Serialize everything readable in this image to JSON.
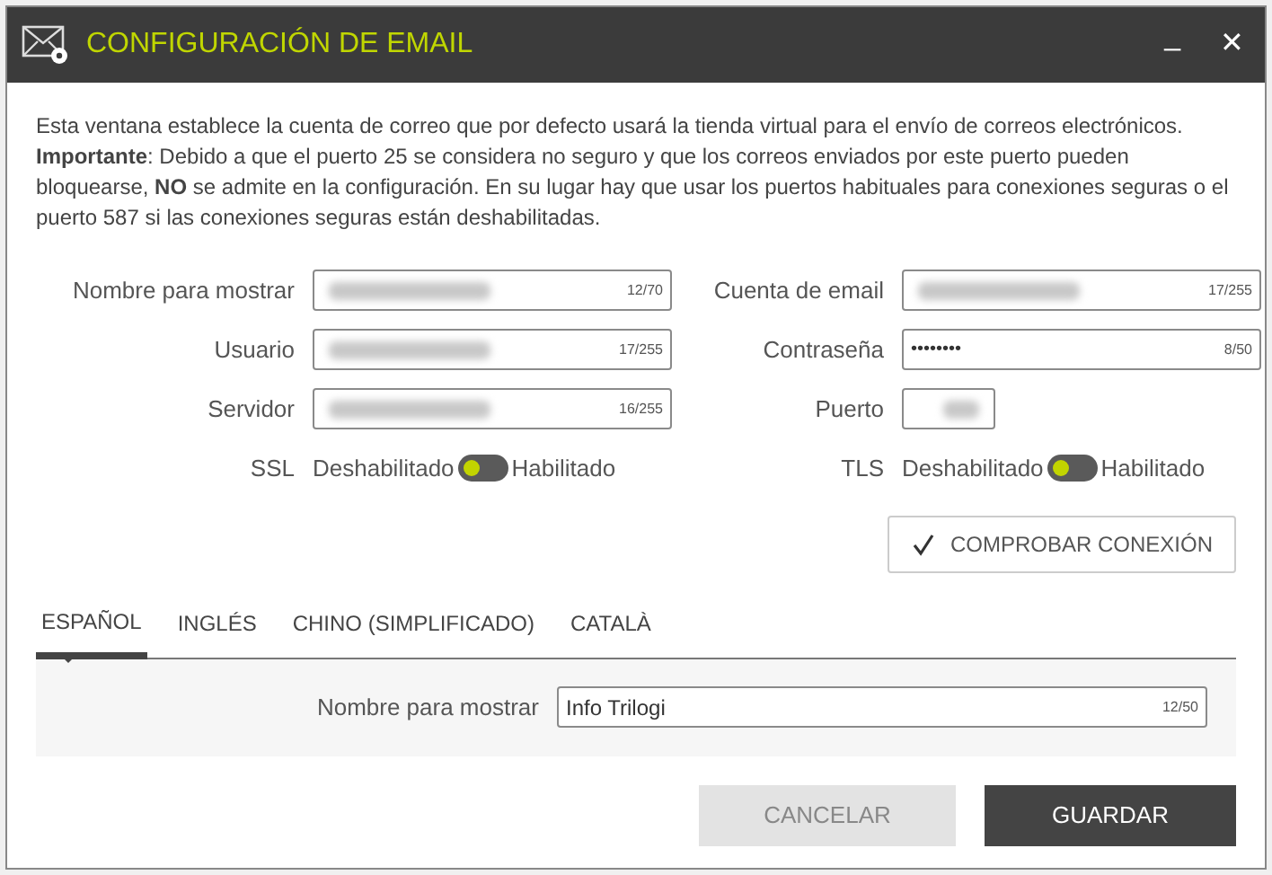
{
  "window": {
    "title": "CONFIGURACIÓN DE EMAIL",
    "minimize": "_",
    "close": "✕"
  },
  "description": "Esta ventana establece la cuenta de correo que por defecto usará la tienda virtual para el envío de correos electrónicos. **Importante**: Debido a que el puerto 25 se considera no seguro y que los correos enviados por este puerto pueden bloquearse, **NO** se admite en la configuración. En su lugar hay que usar los puertos habituales para conexiones seguras o el puerto 587 si las conexiones seguras están deshabilitadas.",
  "left_fields": [
    {
      "label": "Nombre para mostrar",
      "kind": "blurred",
      "counter": "12/70"
    },
    {
      "label": "Usuario",
      "kind": "blurred",
      "counter": "17/255"
    },
    {
      "label": "Servidor",
      "kind": "blurred",
      "counter": "16/255"
    }
  ],
  "right_fields": [
    {
      "label": "Cuenta de email",
      "kind": "blurred",
      "counter": "17/255"
    },
    {
      "label": "Contraseña",
      "kind": "password",
      "value": "••••••••",
      "counter": "8/50"
    },
    {
      "label": "Puerto",
      "kind": "short"
    }
  ],
  "toggles": [
    {
      "label": "SSL",
      "off_label": "Deshabilitado",
      "on_label": "Habilitado",
      "on": false
    },
    {
      "label": "TLS",
      "off_label": "Deshabilitado",
      "on_label": "Habilitado",
      "on": false
    }
  ],
  "test_button": "COMPROBAR CONEXIÓN",
  "tabs": [
    {
      "label": "ESPAÑOL",
      "selected": true
    },
    {
      "label": "INGLÉS",
      "selected": false
    },
    {
      "label": "CHINO (SIMPLIFICADO)",
      "selected": false
    },
    {
      "label": "CATALÀ",
      "selected": false
    }
  ],
  "tab_field": {
    "label": "Nombre para mostrar",
    "value": "Info Trilogi",
    "counter": "12/50"
  },
  "buttons": [
    {
      "label": "CANCELAR",
      "disabled": true
    },
    {
      "label": "GUARDAR",
      "disabled": false
    }
  ]
}
